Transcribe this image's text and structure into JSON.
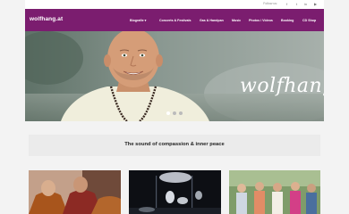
{
  "topbar": {
    "follow_label": "Follow us:",
    "social_icons": [
      "facebook-icon",
      "twitter-icon",
      "linkedin-icon",
      "youtube-icon"
    ],
    "social_glyphs": [
      "f",
      "t",
      "in",
      "▶"
    ]
  },
  "header": {
    "logo": "wolfhang.at",
    "nav": [
      {
        "label": "Biografie",
        "has_dropdown": true
      },
      {
        "label": "Concerts & Festivals"
      },
      {
        "label": "Gas & Handpan"
      },
      {
        "label": "Music"
      },
      {
        "label": "Photos / Videos"
      },
      {
        "label": "Booking"
      },
      {
        "label": "CD Shop"
      }
    ],
    "dropdown_glyph": "▾"
  },
  "hero": {
    "script_text": "wolfhang",
    "slide_count": 3,
    "active_slide": 1
  },
  "tagline": "The sound of compassion & inner peace",
  "colors": {
    "header_bg": "#7b1d6f",
    "page_bg": "#f3f3f3",
    "band_bg": "#ebebeb",
    "dot_active": "#ffffff",
    "dot_inactive": "#bbbbbb"
  }
}
